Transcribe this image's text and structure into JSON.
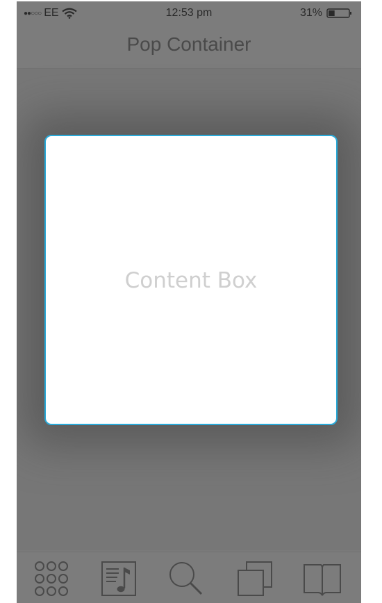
{
  "status_bar": {
    "signal": "●●○○○",
    "carrier": "EE",
    "time": "12:53 pm",
    "battery_percent": "31%",
    "battery_level": 0.31
  },
  "nav": {
    "title": "Pop Container"
  },
  "content_box": {
    "label": "Content Box",
    "border_color": "#29a9d8"
  },
  "tab_bar": {
    "items": [
      {
        "icon": "grid-icon"
      },
      {
        "icon": "music-note-icon"
      },
      {
        "icon": "search-icon"
      },
      {
        "icon": "copy-icon"
      },
      {
        "icon": "book-icon"
      }
    ]
  }
}
